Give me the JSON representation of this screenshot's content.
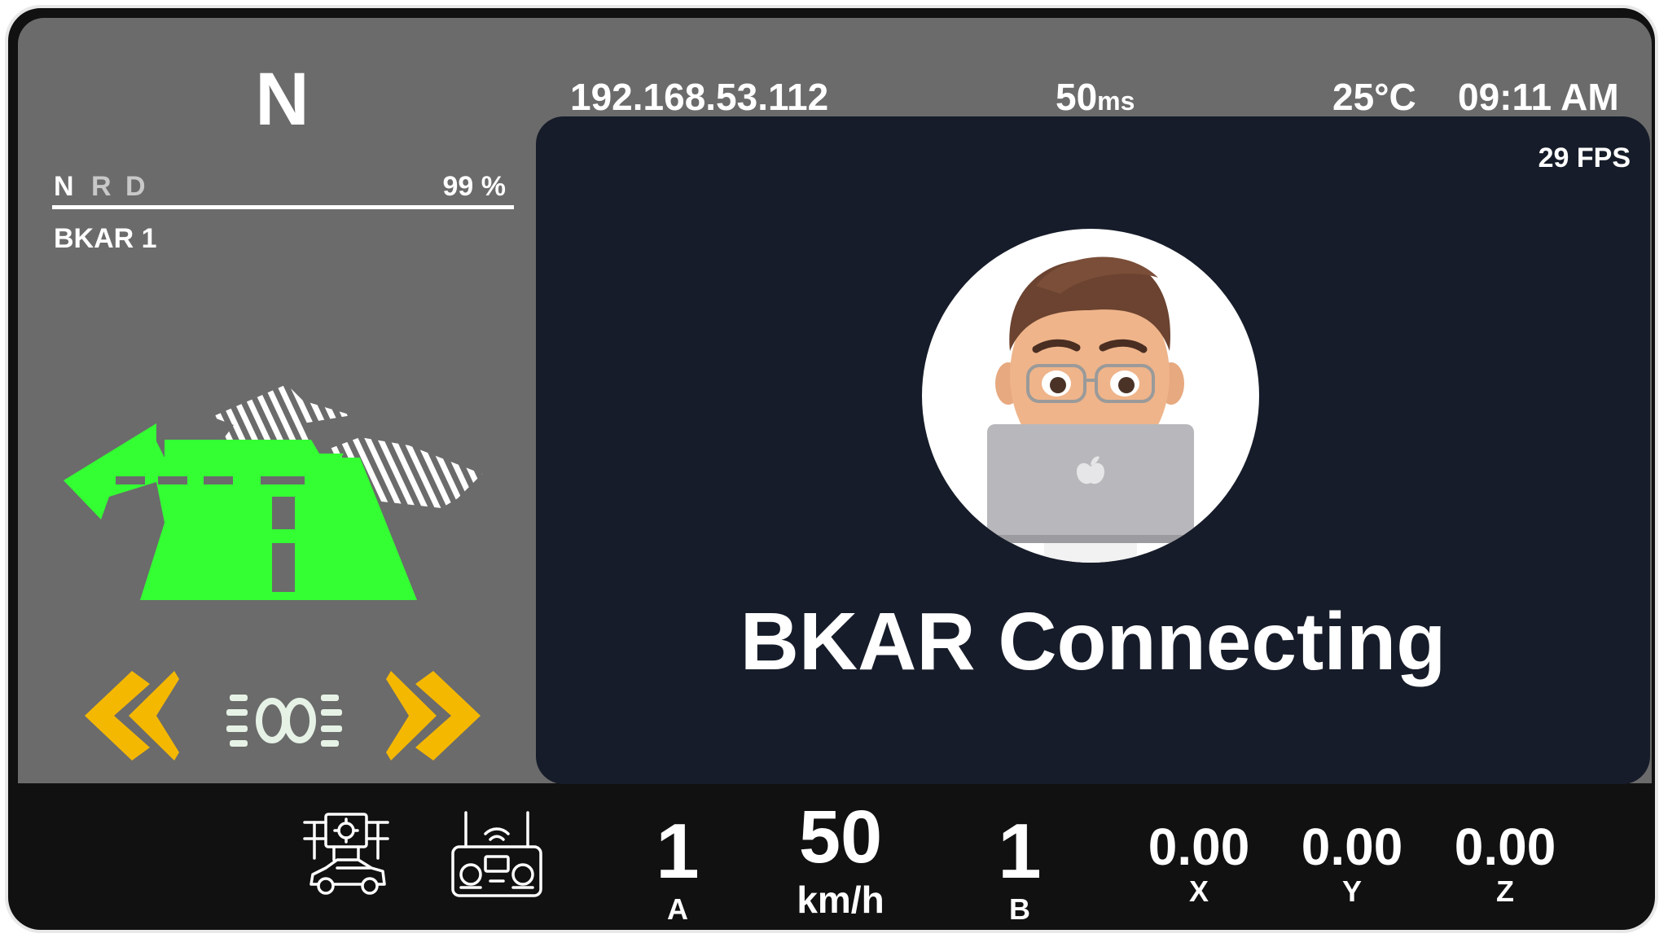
{
  "status_bar": {
    "gear": "N",
    "ip_address": "192.168.53.112",
    "latency_value": "50",
    "latency_unit": "ms",
    "temperature": "25°C",
    "time": "09:11 AM"
  },
  "gear_selector": {
    "options": [
      "N",
      "R",
      "D"
    ],
    "selected": "N",
    "battery": "99 %"
  },
  "vehicle": {
    "name": "BKAR 1"
  },
  "video": {
    "fps": "29 FPS",
    "status": "BKAR Connecting"
  },
  "indicators": {
    "turn_left": "turn-left-signal-icon",
    "headlight": "headlight-icon",
    "turn_right": "turn-right-signal-icon",
    "nav_arrow": "turn-left-navigation-icon"
  },
  "bottom_bar": {
    "icons": [
      "autonomous-driving-icon",
      "remote-controller-icon"
    ],
    "a": {
      "value": "1",
      "label": "A"
    },
    "speed": {
      "value": "50",
      "unit": "km/h"
    },
    "b": {
      "value": "1",
      "label": "B"
    },
    "x": {
      "value": "0.00",
      "label": "X"
    },
    "y": {
      "value": "0.00",
      "label": "Y"
    },
    "z": {
      "value": "0.00",
      "label": "Z"
    }
  },
  "colors": {
    "panel_gray": "#6b6b6b",
    "video_bg": "#161c29",
    "bottom_bg": "#111111",
    "nav_green": "#33ff33",
    "signal_yellow": "#f5b800"
  }
}
